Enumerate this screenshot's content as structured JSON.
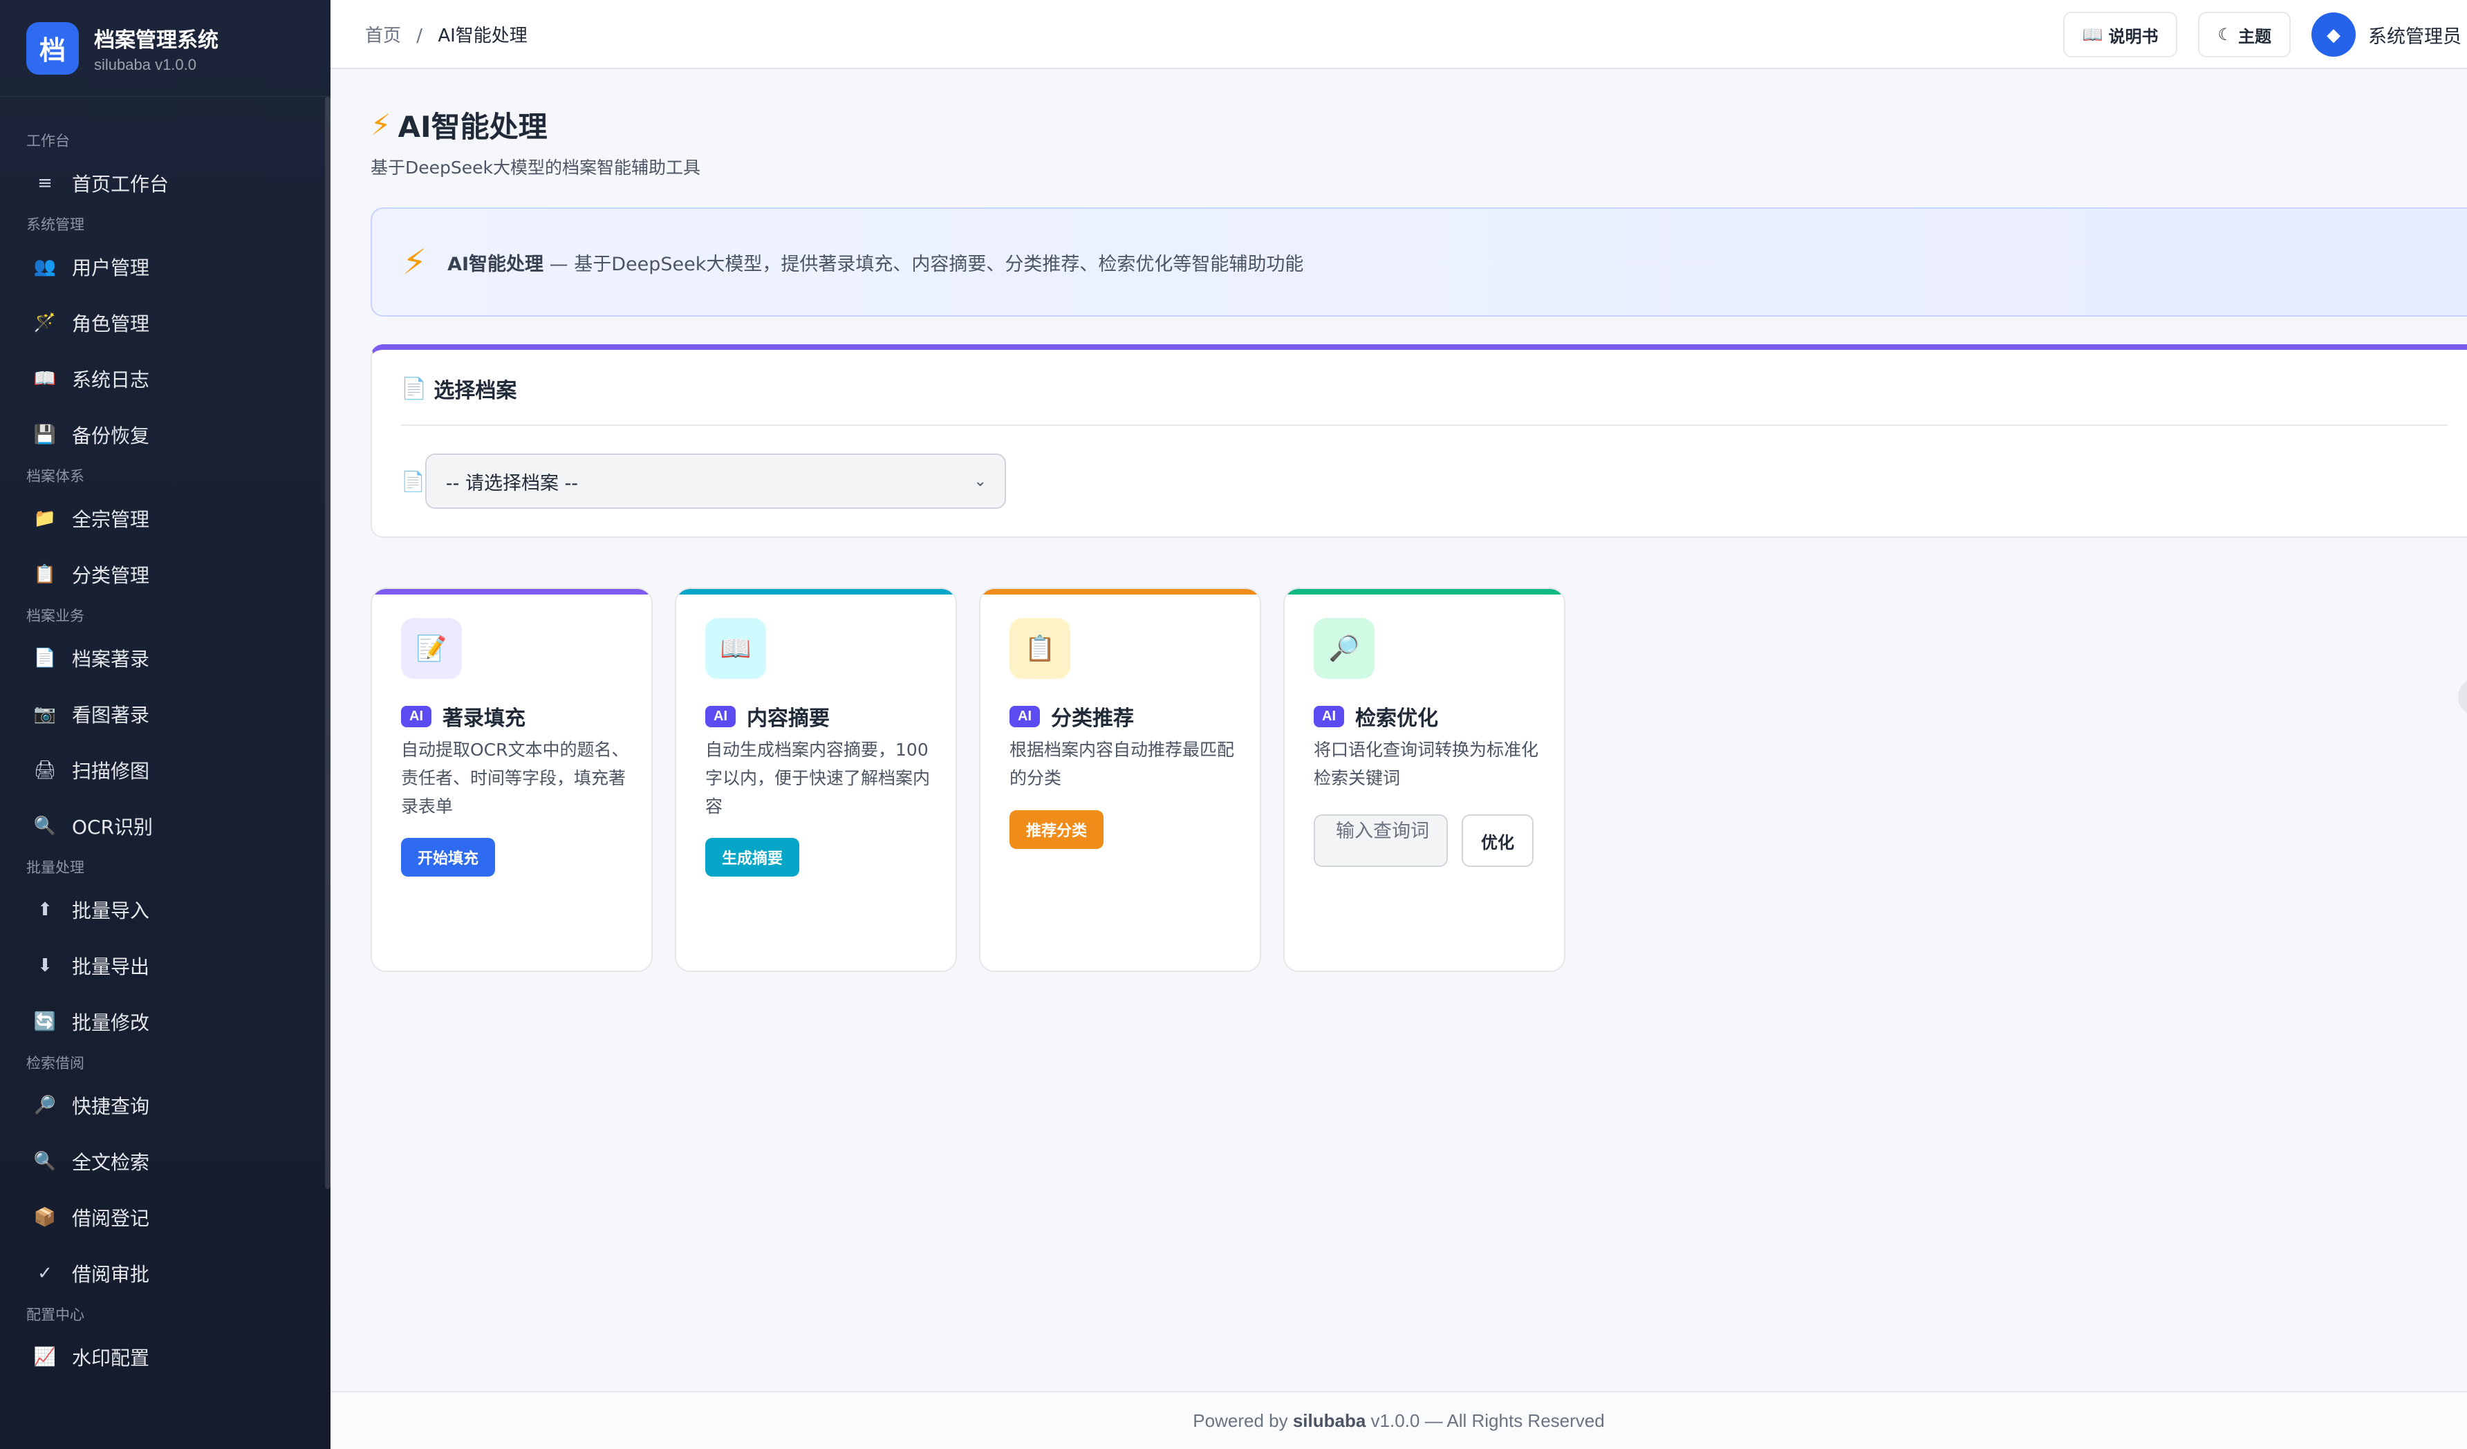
{
  "brand": {
    "logo_char": "档",
    "title": "档案管理系统",
    "version": "silubaba v1.0.0"
  },
  "sidebar": {
    "groups": [
      {
        "title": "工作台",
        "items": [
          {
            "icon": "list-icon",
            "glyph": "≡",
            "label": "首页工作台"
          }
        ]
      },
      {
        "title": "系统管理",
        "items": [
          {
            "icon": "users-icon",
            "glyph": "👥",
            "label": "用户管理"
          },
          {
            "icon": "wand-icon",
            "glyph": "🪄",
            "label": "角色管理"
          },
          {
            "icon": "book-icon",
            "glyph": "📖",
            "label": "系统日志"
          },
          {
            "icon": "floppy-icon",
            "glyph": "💾",
            "label": "备份恢复"
          }
        ]
      },
      {
        "title": "档案体系",
        "items": [
          {
            "icon": "folder-icon",
            "glyph": "📁",
            "label": "全宗管理"
          },
          {
            "icon": "clipboard-icon",
            "glyph": "📋",
            "label": "分类管理"
          }
        ]
      },
      {
        "title": "档案业务",
        "items": [
          {
            "icon": "document-icon",
            "glyph": "📄",
            "label": "档案著录"
          },
          {
            "icon": "camera-icon",
            "glyph": "📷",
            "label": "看图著录"
          },
          {
            "icon": "printer-icon",
            "glyph": "🖨",
            "label": "扫描修图"
          },
          {
            "icon": "search-icon",
            "glyph": "🔍",
            "label": "OCR识别"
          }
        ]
      },
      {
        "title": "批量处理",
        "items": [
          {
            "icon": "arrow-up-icon",
            "glyph": "⬆",
            "label": "批量导入"
          },
          {
            "icon": "arrow-down-icon",
            "glyph": "⬇",
            "label": "批量导出"
          },
          {
            "icon": "refresh-icon",
            "glyph": "🔄",
            "label": "批量修改"
          }
        ]
      },
      {
        "title": "检索借阅",
        "items": [
          {
            "icon": "magnifier-icon",
            "glyph": "🔎",
            "label": "快捷查询"
          },
          {
            "icon": "search-icon",
            "glyph": "🔍",
            "label": "全文检索"
          },
          {
            "icon": "package-icon",
            "glyph": "📦",
            "label": "借阅登记"
          },
          {
            "icon": "check-icon",
            "glyph": "✓",
            "label": "借阅审批"
          }
        ]
      },
      {
        "title": "配置中心",
        "items": [
          {
            "icon": "chart-icon",
            "glyph": "📈",
            "label": "水印配置"
          }
        ]
      }
    ]
  },
  "header": {
    "breadcrumb_home": "首页",
    "breadcrumb_sep": "/",
    "breadcrumb_current": "AI智能处理",
    "manual_icon": "📖",
    "manual_label": "说明书",
    "theme_icon": "☾",
    "theme_label": "主题",
    "user_avatar": "◆",
    "user_name": "系统管理员"
  },
  "page": {
    "title_icon": "⚡",
    "title": "AI智能处理",
    "subtitle": "基于DeepSeek大模型的档案智能辅助工具"
  },
  "banner": {
    "icon": "⚡",
    "strong": "AI智能处理",
    "text": " — 基于DeepSeek大模型，提供著录填充、内容摘要、分类推荐、检索优化等智能辅助功能"
  },
  "select_card": {
    "icon": "📄",
    "title": "选择档案",
    "row_icon": "📄",
    "placeholder": "-- 请选择档案 --",
    "chevron": "⌄"
  },
  "feature_cards": [
    {
      "badge": "AI",
      "name": "著录填充",
      "icon": "pencil-icon",
      "glyph": "📝",
      "desc": "自动提取OCR文本中的题名、责任者、时间等字段，填充著录表单",
      "button": "开始填充",
      "color": "#7c5cf0"
    },
    {
      "badge": "AI",
      "name": "内容摘要",
      "icon": "book-icon",
      "glyph": "📖",
      "desc": "自动生成档案内容摘要，100字以内，便于快速了解档案内容",
      "button": "生成摘要",
      "color": "#06a6c9"
    },
    {
      "badge": "AI",
      "name": "分类推荐",
      "icon": "clipboard-icon",
      "glyph": "📋",
      "desc": "根据档案内容自动推荐最匹配的分类",
      "button": "推荐分类",
      "color": "#f08c1a"
    },
    {
      "badge": "AI",
      "name": "检索优化",
      "icon": "magnifier-icon",
      "glyph": "🔎",
      "desc": "将口语化查询词转换为标准化检索关键词",
      "input_placeholder": "输入查询词",
      "button": "优化",
      "color": "#10b981"
    }
  ],
  "footer": {
    "prefix": "Powered by ",
    "brand": "silubaba",
    "suffix": " v1.0.0 — All Rights Reserved"
  }
}
